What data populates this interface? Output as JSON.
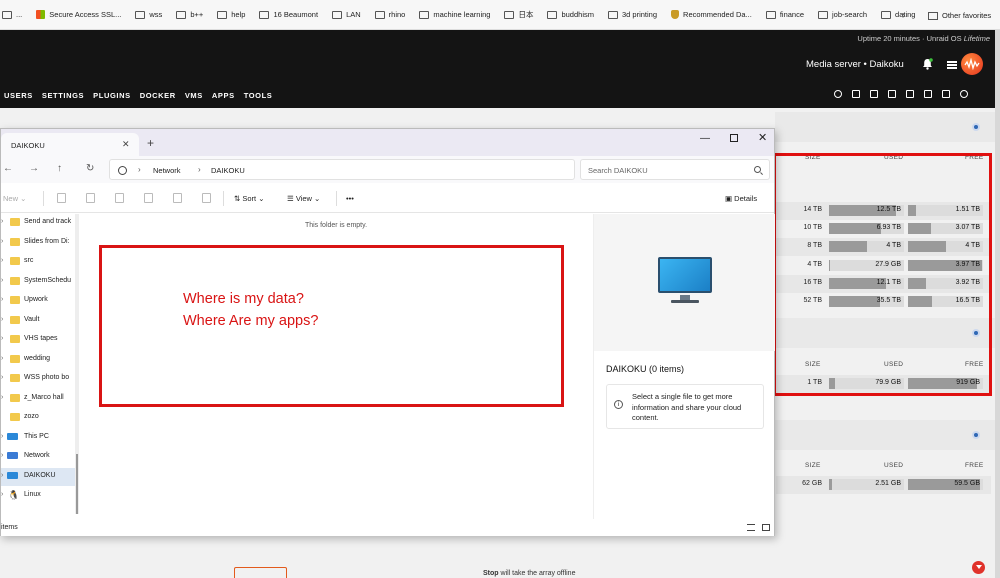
{
  "favorites": {
    "items": [
      {
        "label": "...",
        "icon": "folder-icon"
      },
      {
        "label": "Secure Access SSL...",
        "icon": "microsoft-icon"
      },
      {
        "label": "wss",
        "icon": "folder-icon"
      },
      {
        "label": "b++",
        "icon": "folder-icon"
      },
      {
        "label": "help",
        "icon": "folder-icon"
      },
      {
        "label": "16 Beaumont",
        "icon": "folder-icon"
      },
      {
        "label": "LAN",
        "icon": "folder-icon"
      },
      {
        "label": "rhino",
        "icon": "folder-icon"
      },
      {
        "label": "machine learning",
        "icon": "folder-icon"
      },
      {
        "label": "日本",
        "icon": "folder-icon"
      },
      {
        "label": "buddhism",
        "icon": "folder-icon"
      },
      {
        "label": "3d printing",
        "icon": "folder-icon"
      },
      {
        "label": "Recommended Da...",
        "icon": "shield-icon"
      },
      {
        "label": "finance",
        "icon": "folder-icon"
      },
      {
        "label": "job-search",
        "icon": "folder-icon"
      },
      {
        "label": "dating",
        "icon": "folder-icon"
      }
    ],
    "more": "›",
    "other": "Other favorites"
  },
  "unraid": {
    "uptime_prefix": "Uptime 20 minutes",
    "uptime_sep": "·",
    "license_prefix": "Unraid OS",
    "license": "Lifetime",
    "server_line": "Media server • Daikoku",
    "nav": [
      "USERS",
      "SETTINGS",
      "PLUGINS",
      "DOCKER",
      "VMS",
      "APPS",
      "TOOLS"
    ],
    "toolbar_icons": [
      "search-icon",
      "logout-icon",
      "terminal-icon",
      "copy-icon",
      "feedback-icon",
      "monitor-icon",
      "log-icon",
      "help-icon"
    ],
    "headers": {
      "size": "SIZE",
      "used": "USED",
      "free": "FREE"
    },
    "array_rows": [
      {
        "size": "14 TB",
        "used": "12.5 TB",
        "free": "1.51 TB",
        "used_pct": 0.89,
        "free_pct": 0.11
      },
      {
        "size": "10 TB",
        "used": "6.93 TB",
        "free": "3.07 TB",
        "used_pct": 0.69,
        "free_pct": 0.31
      },
      {
        "size": "8 TB",
        "used": "4 TB",
        "free": "4 TB",
        "used_pct": 0.5,
        "free_pct": 0.5
      },
      {
        "size": "4 TB",
        "used": "27.9 GB",
        "free": "3.97 TB",
        "used_pct": 0.01,
        "free_pct": 0.99
      },
      {
        "size": "16 TB",
        "used": "12.1 TB",
        "free": "3.92 TB",
        "used_pct": 0.76,
        "free_pct": 0.24
      },
      {
        "size": "52 TB",
        "used": "35.5 TB",
        "free": "16.5 TB",
        "used_pct": 0.68,
        "free_pct": 0.32
      }
    ],
    "cache_rows": [
      {
        "size": "1 TB",
        "used": "79.9 GB",
        "free": "919 GB",
        "used_pct": 0.08,
        "free_pct": 0.92
      }
    ],
    "flash_rows": [
      {
        "size": "62 GB",
        "used": "2.51 GB",
        "free": "59.5 GB",
        "used_pct": 0.04,
        "free_pct": 0.96
      }
    ],
    "stop_bold": "Stop",
    "stop_text": " will take the array offline"
  },
  "explorer": {
    "tab_title": "DAIKOKU",
    "new_tab": "+",
    "breadcrumb": [
      "Network",
      "DAIKOKU"
    ],
    "search_placeholder": "Search DAIKOKU",
    "commands": {
      "new": "New",
      "sort": "Sort",
      "view": "View",
      "more": "•••",
      "details": "Details"
    },
    "sidebar": [
      {
        "label": "Send and track",
        "icon": "folder-icon",
        "chevron": true
      },
      {
        "label": "Slides from Di:",
        "icon": "folder-icon",
        "chevron": true
      },
      {
        "label": "src",
        "icon": "folder-icon",
        "chevron": true
      },
      {
        "label": "SystemSchedu",
        "icon": "folder-icon",
        "chevron": true
      },
      {
        "label": "Upwork",
        "icon": "folder-icon",
        "chevron": true
      },
      {
        "label": "Vault",
        "icon": "folder-icon",
        "chevron": true
      },
      {
        "label": "VHS tapes",
        "icon": "folder-icon",
        "chevron": true
      },
      {
        "label": "wedding",
        "icon": "folder-icon",
        "chevron": true
      },
      {
        "label": "WSS photo bo",
        "icon": "folder-icon",
        "chevron": true
      },
      {
        "label": "z_Marco hall",
        "icon": "folder-icon",
        "chevron": true
      },
      {
        "label": "zozo",
        "icon": "folder-icon",
        "chevron": false
      },
      {
        "label": "This PC",
        "icon": "this-pc-icon",
        "chevron": true
      },
      {
        "label": "Network",
        "icon": "network-icon",
        "chevron": true
      },
      {
        "label": "DAIKOKU",
        "icon": "computer-icon",
        "chevron": true,
        "selected": true
      },
      {
        "label": "Linux",
        "icon": "linux-icon",
        "chevron": true
      }
    ],
    "empty_message": "This folder is empty.",
    "annotation_line1": "Where is my data?",
    "annotation_line2": "Where Are my apps?",
    "details_title": "DAIKOKU (0 items)",
    "details_info": "Select a single file to get more information and share your cloud content.",
    "status": "items"
  }
}
